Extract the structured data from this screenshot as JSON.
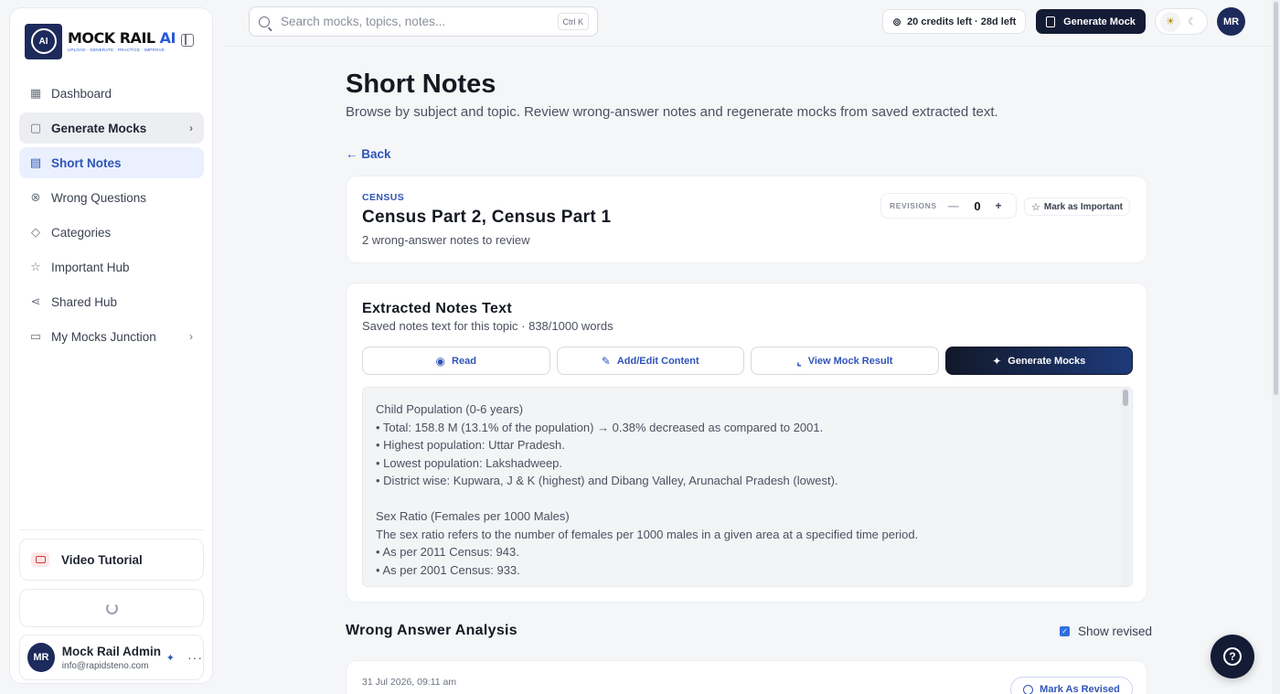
{
  "brand": {
    "name_main": "MOCK RAIL",
    "name_ai": "AI",
    "tagline": "UPLOAD · GENERATE · PRACTICE · IMPROVE",
    "mark": "AI"
  },
  "sidebar": {
    "items": [
      {
        "label": "Dashboard",
        "icon": "grid-icon"
      },
      {
        "label": "Generate Mocks",
        "icon": "file-plus-icon"
      },
      {
        "label": "Short Notes",
        "icon": "notebook-icon"
      },
      {
        "label": "Wrong Questions",
        "icon": "x-circle-icon"
      },
      {
        "label": "Categories",
        "icon": "tags-icon"
      },
      {
        "label": "Important Hub",
        "icon": "star-icon"
      },
      {
        "label": "Shared Hub",
        "icon": "share-icon"
      },
      {
        "label": "My Mocks Junction",
        "icon": "folder-icon"
      }
    ],
    "video_tutorial": "Video Tutorial",
    "user": {
      "initials": "MR",
      "name": "Mock Rail Admin",
      "email": "info@rapidsteno.com"
    }
  },
  "topbar": {
    "search_placeholder": "Search mocks, topics, notes...",
    "shortcut": "Ctrl K",
    "credits": "20 credits left · 28d left",
    "generate_label": "Generate Mock",
    "avatar": "MR"
  },
  "page": {
    "title": "Short Notes",
    "subtitle": "Browse by subject and topic. Review wrong-answer notes and regenerate mocks from saved extracted text.",
    "back": "← Back"
  },
  "topic": {
    "tag": "CENSUS",
    "title": "Census Part 2, Census Part 1",
    "meta": "2 wrong-answer notes to review",
    "revisions_label": "REVISIONS",
    "revisions": "0",
    "mark_important": "Mark as Important"
  },
  "notes": {
    "title": "Extracted Notes Text",
    "subtitle": "Saved notes text for this topic · 838/1000 words",
    "actions": [
      "Read",
      "Add/Edit Content",
      "View Mock Result",
      "Generate Mocks"
    ],
    "text": "Child Population (0-6 years)\n• Total: 158.8 M (13.1% of the population) → 0.38% decreased as compared to 2001.\n• Highest population: Uttar Pradesh.\n• Lowest population: Lakshadweep.\n• District wise: Kupwara, J & K (highest) and Dibang Valley, Arunachal Pradesh (lowest).\n\nSex Ratio (Females per 1000 Males)\nThe sex ratio refers to the number of females per 1000 males in a given area at a specified time period.\n• As per 2011 Census: 943.\n• As per 2001 Census: 933."
  },
  "wrong_answers": {
    "title": "Wrong Answer Analysis",
    "show_revised": "Show revised",
    "entries": [
      {
        "date": "31 Jul 2026, 09:11 am",
        "action": "Mark As Revised"
      }
    ]
  },
  "colors": {
    "accent": "#2f55b8",
    "dark": "#141b35"
  }
}
